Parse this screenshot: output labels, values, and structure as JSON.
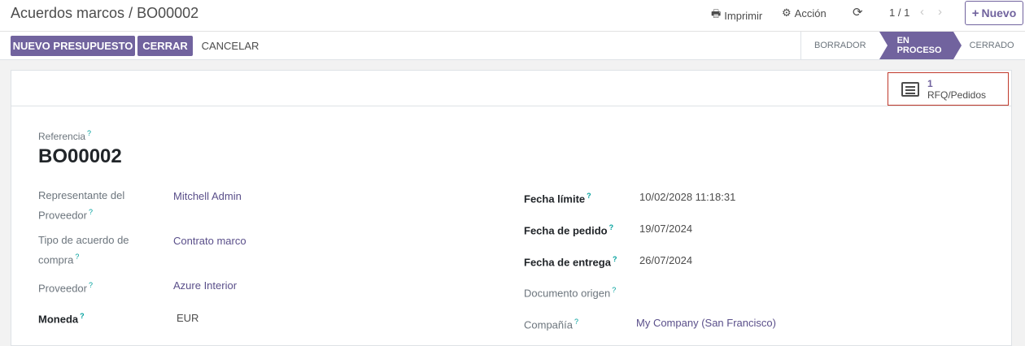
{
  "breadcrumb": {
    "parent": "Acuerdos marcos",
    "current": "BO00002"
  },
  "toolbar": {
    "print": "Imprimir",
    "action": "Acción",
    "pager": "1 / 1",
    "new": "Nuevo"
  },
  "buttons": {
    "new_quote": "NUEVO PRESUPUESTO",
    "close": "CERRAR",
    "cancel": "CANCELAR"
  },
  "status": {
    "draft": "BORRADOR",
    "in_progress": "EN PROCESO",
    "closed": "CERRADO"
  },
  "smart_button": {
    "count": "1",
    "label": "RFQ/Pedidos"
  },
  "help_mark": "?",
  "form": {
    "reference_label": "Referencia",
    "reference": "BO00002",
    "left": [
      {
        "label": "Representante del Proveedor",
        "value": "Mitchell Admin"
      },
      {
        "label": "Tipo de acuerdo de compra",
        "value": "Contrato marco"
      },
      {
        "label": "Proveedor",
        "value": "Azure Interior"
      },
      {
        "label": "Moneda",
        "value": "EUR"
      }
    ],
    "right": [
      {
        "label": "Fecha límite",
        "value": "10/02/2028 11:18:31"
      },
      {
        "label": "Fecha de pedido",
        "value": "19/07/2024"
      },
      {
        "label": "Fecha de entrega",
        "value": "26/07/2024"
      },
      {
        "label": "Documento origen",
        "value": ""
      },
      {
        "label": "Compañía",
        "value": "My Company (San Francisco)"
      }
    ]
  }
}
